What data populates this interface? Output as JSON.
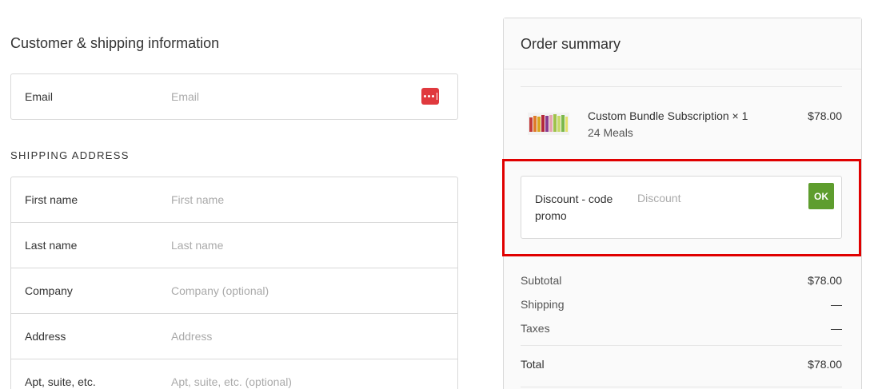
{
  "customer": {
    "section_title": "Customer & shipping information",
    "email_label": "Email",
    "email_placeholder": "Email",
    "shipping_heading": "SHIPPING ADDRESS",
    "fields": [
      {
        "label": "First name",
        "placeholder": "First name"
      },
      {
        "label": "Last name",
        "placeholder": "Last name"
      },
      {
        "label": "Company",
        "placeholder": "Company (optional)"
      },
      {
        "label": "Address",
        "placeholder": "Address"
      },
      {
        "label": "Apt, suite, etc.",
        "placeholder": "Apt, suite, etc. (optional)"
      }
    ]
  },
  "summary": {
    "title": "Order summary",
    "product": {
      "name": "Custom Bundle Subscription × 1",
      "variant": "24 Meals",
      "price": "$78.00"
    },
    "discount": {
      "label": "Discount - code promo",
      "placeholder": "Discount",
      "button": "OK"
    },
    "subtotal_label": "Subtotal",
    "subtotal_value": "$78.00",
    "shipping_label": "Shipping",
    "shipping_value": "—",
    "taxes_label": "Taxes",
    "taxes_value": "—",
    "total_label": "Total",
    "total_value": "$78.00"
  },
  "colors": {
    "accent_button": "#5e9d2e",
    "password_manager_icon": "#e0393e",
    "highlight": "#e00000"
  }
}
